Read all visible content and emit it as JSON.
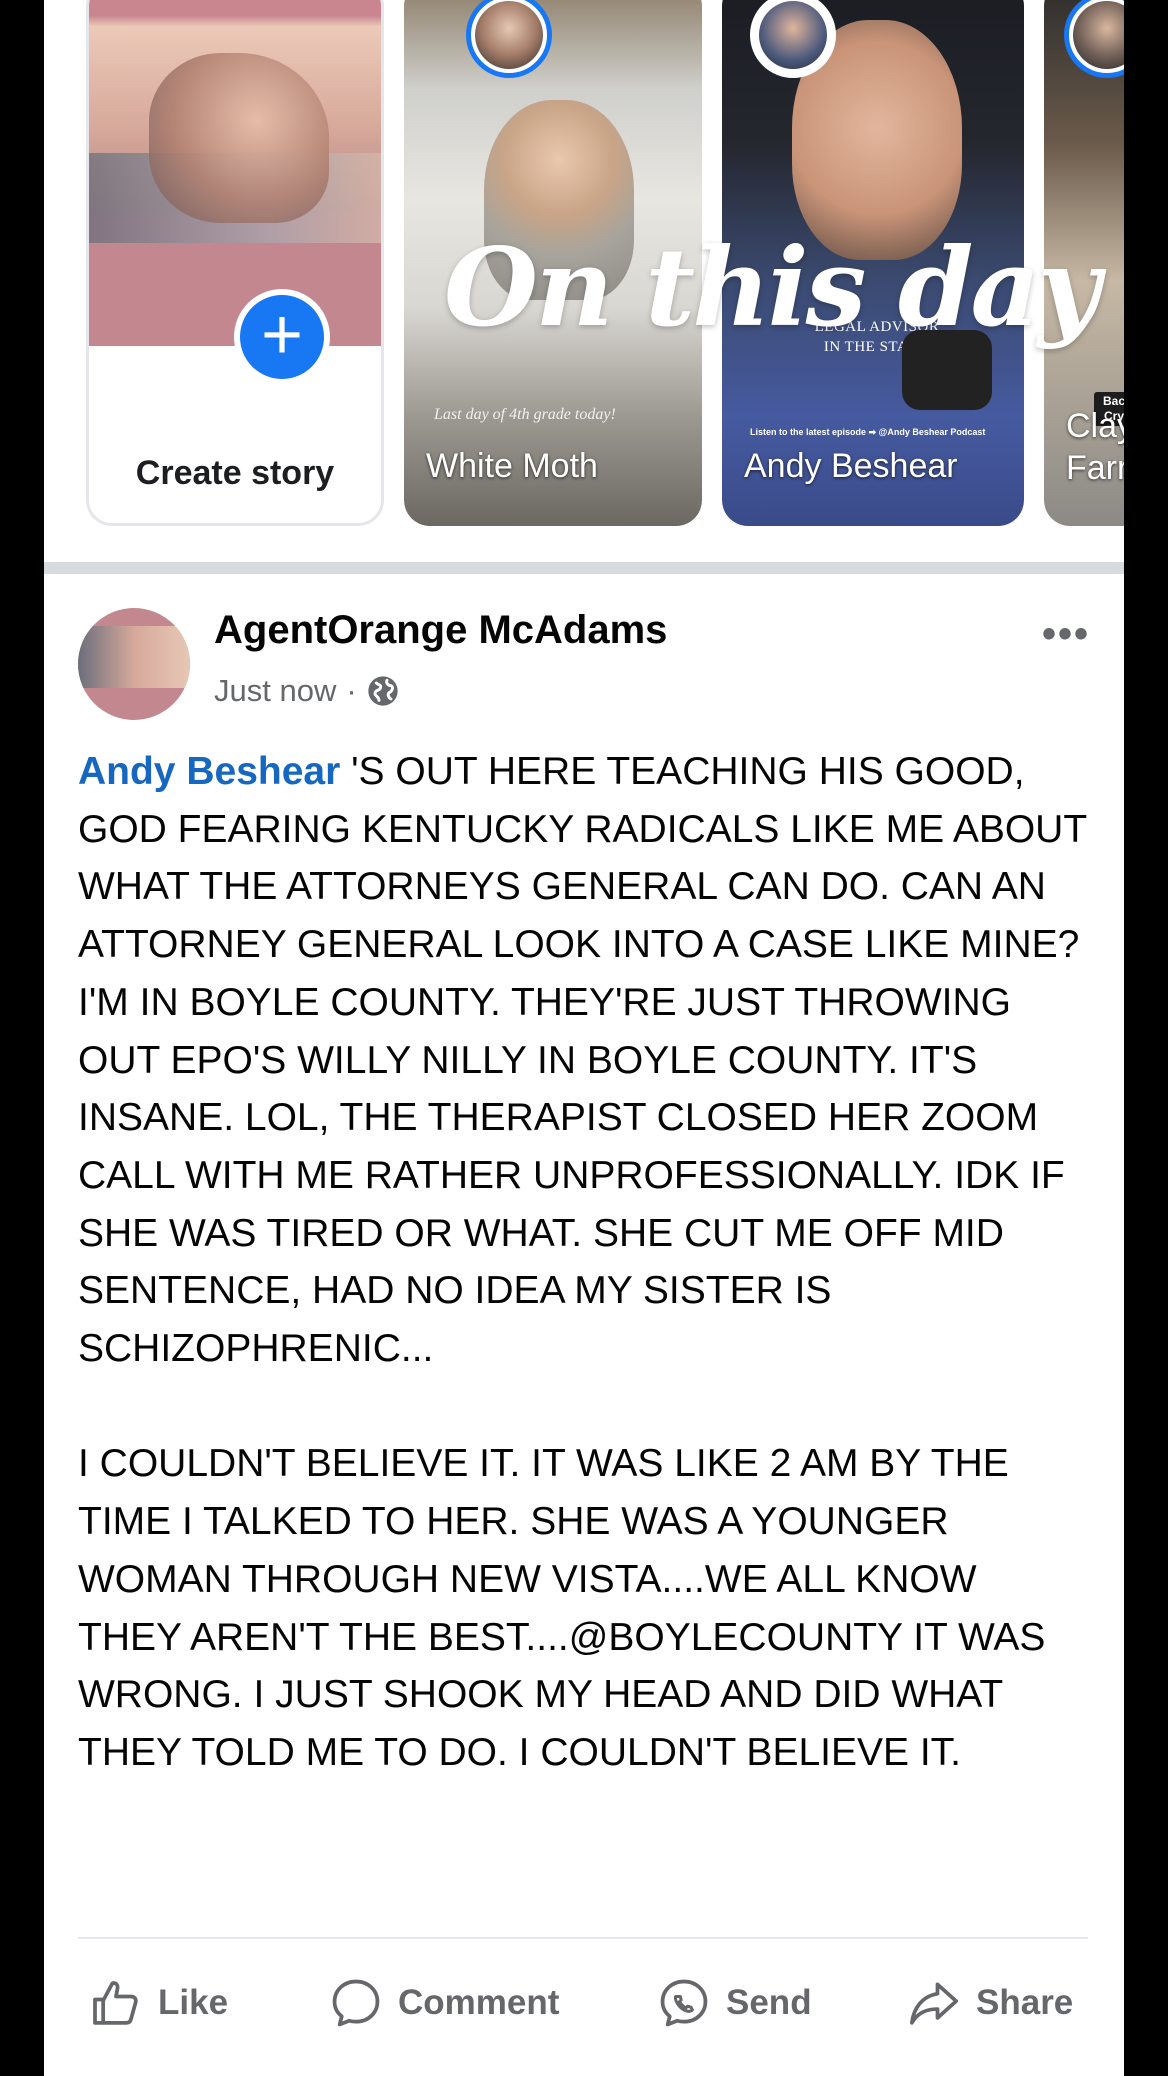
{
  "stories": {
    "create_label": "Create story",
    "items": [
      {
        "name": "White Moth",
        "caption": "Last day of 4th grade today!"
      },
      {
        "name": "Andy Beshear",
        "overlay_lines": [
          "LEGAL ADVISOR",
          "IN THE STATE."
        ],
        "footer": "Listen to the latest episode ➡ @Andy Beshear Podcast"
      },
      {
        "name": "Clay Farr",
        "tag": "Bac Cry"
      }
    ],
    "overlay_title": "On this day"
  },
  "post": {
    "author": "AgentOrange McAdams",
    "time": "Just now",
    "mention": "Andy Beshear",
    "paragraph1": "'S OUT HERE TEACHING HIS GOOD, GOD FEARING KENTUCKY RADICALS LIKE ME ABOUT WHAT THE ATTORNEYS GENERAL CAN DO. CAN AN ATTORNEY GENERAL LOOK INTO A CASE LIKE MINE? I'M IN BOYLE COUNTY. THEY'RE JUST THROWING OUT EPO'S WILLY NILLY IN BOYLE COUNTY. IT'S INSANE. LOL, THE THERAPIST CLOSED HER ZOOM CALL WITH ME RATHER UNPROFESSIONALLY. IDK IF SHE WAS TIRED OR WHAT. SHE CUT ME OFF MID SENTENCE, HAD NO IDEA MY SISTER IS SCHIZOPHRENIC...",
    "paragraph2": "I COULDN'T BELIEVE IT. IT WAS LIKE 2 AM BY THE TIME I TALKED TO HER. SHE WAS A YOUNGER WOMAN THROUGH NEW VISTA....WE ALL KNOW THEY AREN'T THE BEST....@BOYLECOUNTY IT WAS WRONG. I JUST SHOOK MY HEAD AND DID WHAT THEY TOLD ME TO DO. I COULDN'T BELIEVE IT."
  },
  "actions": {
    "like": "Like",
    "comment": "Comment",
    "send": "Send",
    "share": "Share"
  },
  "colors": {
    "accent": "#1877f2",
    "mention": "#1667c0",
    "muted": "#65676b"
  }
}
